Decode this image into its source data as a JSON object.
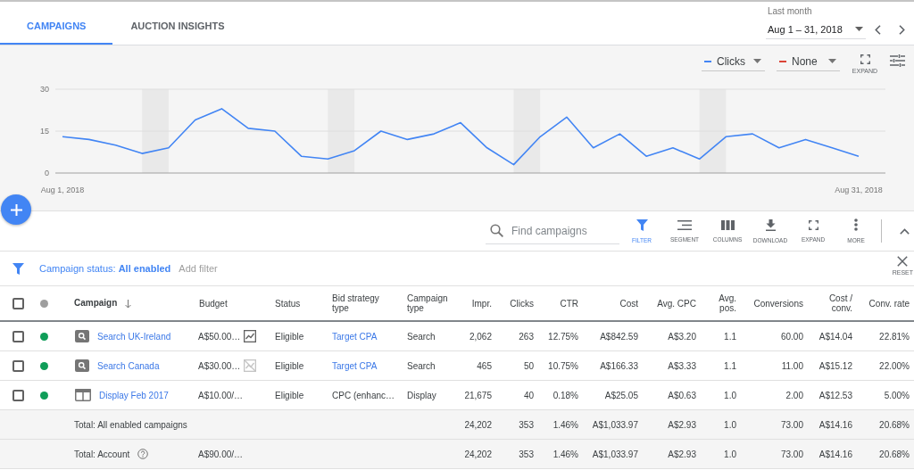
{
  "tabs": [
    {
      "label": "CAMPAIGNS",
      "selected": true
    },
    {
      "label": "AUCTION INSIGHTS",
      "selected": false
    }
  ],
  "date_range": {
    "label": "Last month",
    "value": "Aug 1 – 31, 2018"
  },
  "chart": {
    "metrics": [
      {
        "label": "Clicks",
        "color": "#4285f4"
      },
      {
        "label": "None",
        "color": "#db4437"
      }
    ],
    "expand_label": "EXPAND",
    "chart_data": {
      "type": "line",
      "categories": [
        "Aug 1, 2018",
        null,
        null,
        null,
        null,
        null,
        null,
        null,
        null,
        null,
        null,
        null,
        null,
        null,
        null,
        null,
        null,
        null,
        null,
        null,
        null,
        null,
        null,
        null,
        null,
        null,
        null,
        null,
        null,
        null,
        "Aug 31, 2018"
      ],
      "ylim": [
        0,
        30
      ],
      "yticks": [
        0,
        15,
        30
      ],
      "series": [
        {
          "color": "#4285f4",
          "values": [
            13,
            12,
            10,
            7,
            9,
            19,
            23,
            16,
            15,
            6,
            5,
            8,
            15,
            12,
            14,
            18,
            9,
            3,
            13,
            20,
            9,
            14,
            6,
            9,
            5,
            13,
            14,
            9,
            12,
            9,
            6
          ]
        }
      ]
    }
  },
  "toolbar": {
    "search": {
      "placeholder": "Find campaigns"
    },
    "buttons": [
      {
        "kind": "filter",
        "label": "FILTER",
        "selected": true
      },
      {
        "kind": "segment",
        "label": "SEGMENT",
        "selected": false
      },
      {
        "kind": "columns",
        "label": "COLUMNS",
        "selected": false
      },
      {
        "kind": "download",
        "label": "DOWNLOAD",
        "selected": false
      },
      {
        "kind": "expand",
        "label": "EXPAND",
        "selected": false
      },
      {
        "kind": "more",
        "label": "MORE",
        "selected": false
      }
    ]
  },
  "filter_bar": {
    "filter": "Campaign status: **All enabled**",
    "add_filter": "Add filter",
    "reset": "RESET"
  },
  "table": {
    "select_all": {
      "checked": false
    },
    "columns": [
      {
        "label": "Campaign",
        "kind": "text",
        "sorted": true
      },
      {
        "label": "Budget",
        "kind": "text",
        "sorted": false
      },
      {
        "label": "Status",
        "kind": "text",
        "sorted": false
      },
      {
        "label": "Bid strategy type",
        "kind": "text",
        "sorted": false
      },
      {
        "label": "Campaign type",
        "kind": "text",
        "sorted": false
      },
      {
        "label": "Impr.",
        "kind": "number",
        "sorted": false
      },
      {
        "label": "Clicks",
        "kind": "number",
        "sorted": false
      },
      {
        "label": "CTR",
        "kind": "number",
        "sorted": false
      },
      {
        "label": "Cost",
        "kind": "number",
        "sorted": false
      },
      {
        "label": "Avg. CPC",
        "kind": "number",
        "sorted": false
      },
      {
        "label": "Avg. pos.",
        "kind": "number",
        "sorted": false
      },
      {
        "label": "Conversions",
        "kind": "number",
        "sorted": false
      },
      {
        "label": "Cost / conv.",
        "kind": "number",
        "sorted": false
      },
      {
        "label": "Conv. rate",
        "kind": "number",
        "sorted": false
      }
    ],
    "rows": [
      {
        "kind": "campaign",
        "checked": false,
        "color": "#0f9d58",
        "channel_icon": {
          "kind": "search"
        },
        "name": "Search UK-Ireland",
        "budget": "A$50.00…",
        "budget_icon": {
          "kind": "trend"
        },
        "status": "Eligible",
        "bid_strategy": {
          "text": "Target CPA",
          "link": true
        },
        "campaign_type": "Search",
        "values": [
          "2,062",
          "263",
          "12.75%",
          "A$842.59",
          "A$3.20",
          "1.1",
          "60.00",
          "A$14.04",
          "22.81%"
        ]
      },
      {
        "kind": "campaign",
        "checked": false,
        "color": "#0f9d58",
        "channel_icon": {
          "kind": "search"
        },
        "name": "Search Canada",
        "budget": "A$30.00…",
        "budget_icon": {
          "kind": "trend-off"
        },
        "status": "Eligible",
        "bid_strategy": {
          "text": "Target CPA",
          "link": true
        },
        "campaign_type": "Search",
        "values": [
          "465",
          "50",
          "10.75%",
          "A$166.33",
          "A$3.33",
          "1.1",
          "11.00",
          "A$15.12",
          "22.00%"
        ]
      },
      {
        "kind": "campaign",
        "checked": false,
        "color": "#0f9d58",
        "channel_icon": {
          "kind": "display"
        },
        "name": "Display Feb 2017",
        "budget": "A$10.00/…",
        "status": "Eligible",
        "bid_strategy": {
          "text": "CPC (enhanc…",
          "link": false
        },
        "campaign_type": "Display",
        "values": [
          "21,675",
          "40",
          "0.18%",
          "A$25.05",
          "A$0.63",
          "1.0",
          "2.00",
          "A$12.53",
          "5.00%"
        ]
      },
      {
        "kind": "total",
        "name": "Total: All enabled campaigns",
        "help": false,
        "values": [
          "24,202",
          "353",
          "1.46%",
          "A$1,033.97",
          "A$2.93",
          "1.0",
          "73.00",
          "A$14.16",
          "20.68%"
        ]
      },
      {
        "kind": "total",
        "name": "Total: Account",
        "help": true,
        "budget": "A$90.00/…",
        "values": [
          "24,202",
          "353",
          "1.46%",
          "A$1,033.97",
          "A$2.93",
          "1.0",
          "73.00",
          "A$14.16",
          "20.68%"
        ]
      }
    ]
  }
}
